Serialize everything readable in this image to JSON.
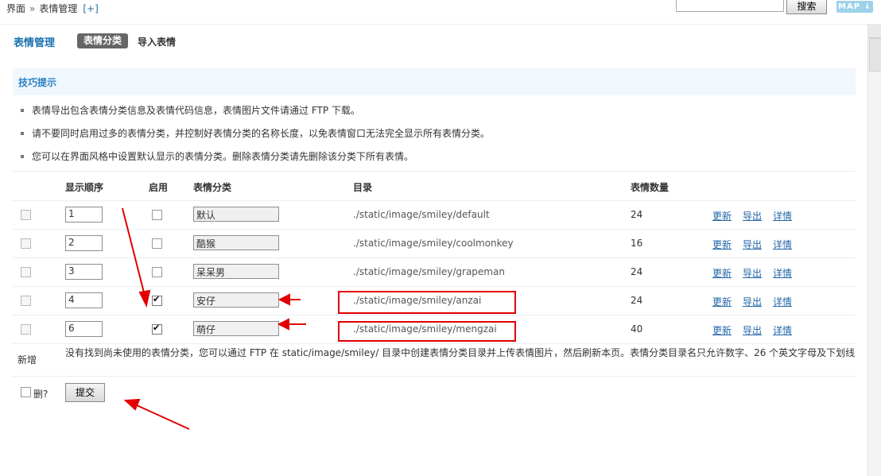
{
  "breadcrumb": {
    "part1": "界面",
    "separator": "»",
    "part2": "表情管理",
    "add": "[+]"
  },
  "search": {
    "button_label": "搜索",
    "value": ""
  },
  "map_button": "MAP",
  "header": {
    "title": "表情管理",
    "tab_active": "表情分类",
    "tab_import": "导入表情"
  },
  "tips": {
    "title": "技巧提示",
    "items": [
      "表情导出包含表情分类信息及表情代码信息，表情图片文件请通过 FTP 下载。",
      "请不要同时启用过多的表情分类，并控制好表情分类的名称长度，以免表情窗口无法完全显示所有表情分类。",
      "您可以在界面风格中设置默认显示的表情分类。删除表情分类请先删除该分类下所有表情。"
    ]
  },
  "table": {
    "headers": {
      "order": "显示顺序",
      "enabled": "启用",
      "category": "表情分类",
      "dir": "目录",
      "count": "表情数量"
    },
    "rows": [
      {
        "order": "1",
        "enabled": false,
        "name": "默认",
        "dir": "./static/image/smiley/default",
        "count": "24"
      },
      {
        "order": "2",
        "enabled": false,
        "name": "酷猴",
        "dir": "./static/image/smiley/coolmonkey",
        "count": "16"
      },
      {
        "order": "3",
        "enabled": false,
        "name": "呆呆男",
        "dir": "./static/image/smiley/grapeman",
        "count": "24"
      },
      {
        "order": "4",
        "enabled": true,
        "name": "安仔",
        "dir": "./static/image/smiley/anzai",
        "count": "24"
      },
      {
        "order": "6",
        "enabled": true,
        "name": "萌仔",
        "dir": "./static/image/smiley/mengzai",
        "count": "40"
      }
    ],
    "actions": {
      "update": "更新",
      "export": "导出",
      "detail": "详情"
    }
  },
  "add_row": {
    "label": "新增",
    "text": "没有找到尚未使用的表情分类，您可以通过 FTP 在 static/image/smiley/ 目录中创建表情分类目录并上传表情图片，然后刷新本页。表情分类目录名只允许数字、26 个英文字母及下划线"
  },
  "footer": {
    "delete_label": "删?",
    "submit_label": "提交"
  },
  "colors": {
    "accent": "#1c72b0",
    "annotation": "#e00000",
    "link": "#2366a8"
  }
}
